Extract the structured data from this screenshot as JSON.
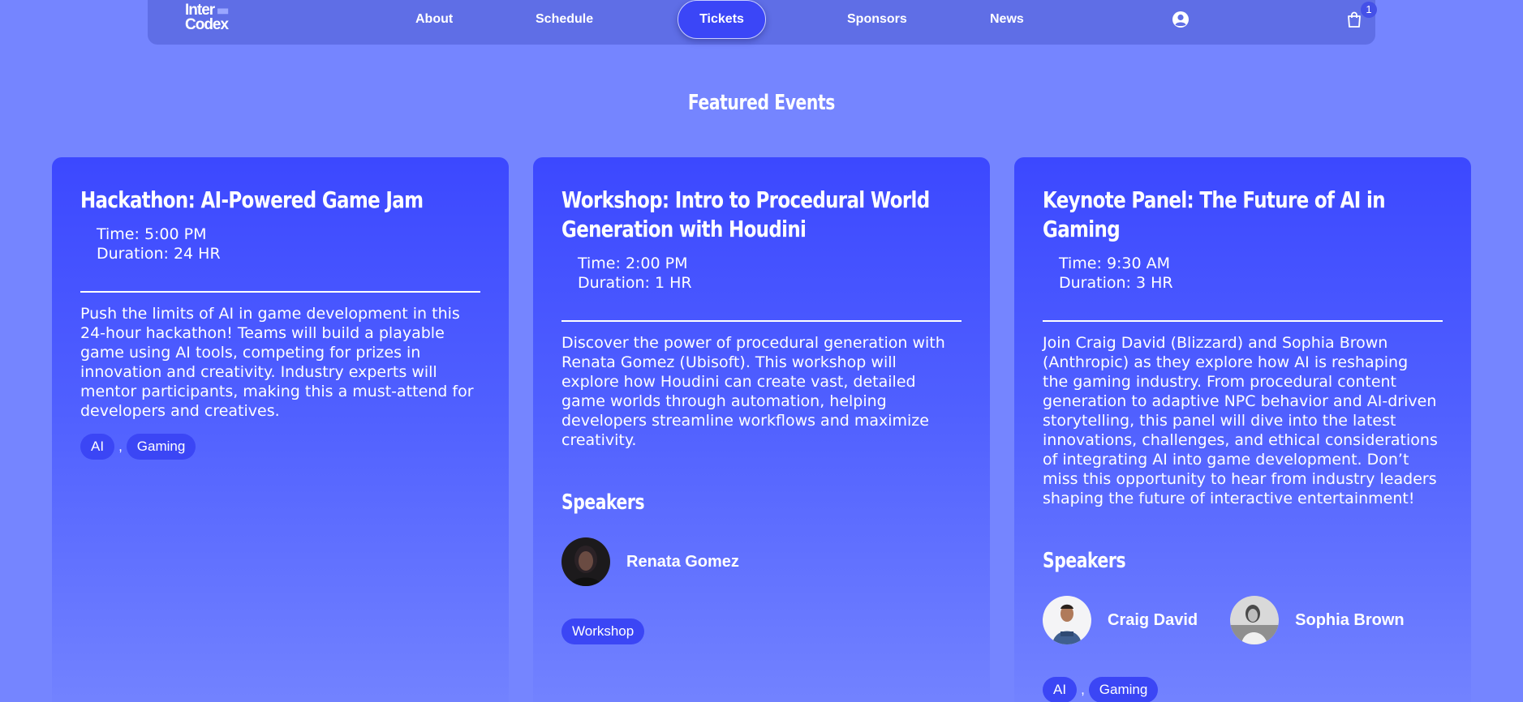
{
  "nav": {
    "logo_line1": "Inter",
    "logo_mark": "■■",
    "logo_line2": "Codex",
    "about": "About",
    "schedule": "Schedule",
    "tickets": "Tickets",
    "sponsors": "Sponsors",
    "news": "News",
    "cart_count": "1",
    "icons": {
      "account": "user-circle-icon",
      "cart": "shopping-bag-icon"
    }
  },
  "section": {
    "title": "Featured Events"
  },
  "events": [
    {
      "title": "Hackathon: AI-Powered Game Jam",
      "time": "Time: 5:00 PM",
      "duration": "Duration: 24 HR",
      "description": "Push the limits of AI in game development in this 24-hour hackathon! Teams will build a playable game using AI tools, competing for prizes in innovation and creativity. Industry experts will mentor participants, making this a must-attend for developers and creatives.",
      "tags": [
        "AI",
        "Gaming"
      ],
      "tag_separator": ","
    },
    {
      "title": "Workshop: Intro to Procedural World Generation with Houdini",
      "time": "Time: 2:00 PM",
      "duration": "Duration: 1 HR",
      "description": "Discover the power of procedural generation with Renata Gomez (Ubisoft). This workshop will explore how Houdini can create vast, detailed game worlds through automation, helping developers streamline workflows and maximize creativity.",
      "speakers_title": "Speakers",
      "speakers": [
        {
          "name": "Renata Gomez"
        }
      ],
      "tags": [
        "Workshop"
      ]
    },
    {
      "title": "Keynote Panel: The Future of AI in Gaming",
      "time": "Time: 9:30 AM",
      "duration": "Duration: 3 HR",
      "description": "Join Craig David (Blizzard) and Sophia Brown (Anthropic) as they explore how AI is reshaping the gaming industry. From procedural content generation to adaptive NPC behavior and AI-driven storytelling, this panel will dive into the latest innovations, challenges, and ethical considerations of integrating AI into game development. Don’t miss this opportunity to hear from industry leaders shaping the future of interactive entertainment!",
      "speakers_title": "Speakers",
      "speakers": [
        {
          "name": "Craig David"
        },
        {
          "name": "Sophia Brown"
        }
      ],
      "tags": [
        "AI",
        "Gaming"
      ],
      "tag_separator": ","
    }
  ],
  "colors": {
    "background": "#7585ff",
    "nav": "#5f6ee6",
    "accent": "#3b46f7",
    "card_top": "#3c48ff",
    "tag": "#3b46f5"
  }
}
